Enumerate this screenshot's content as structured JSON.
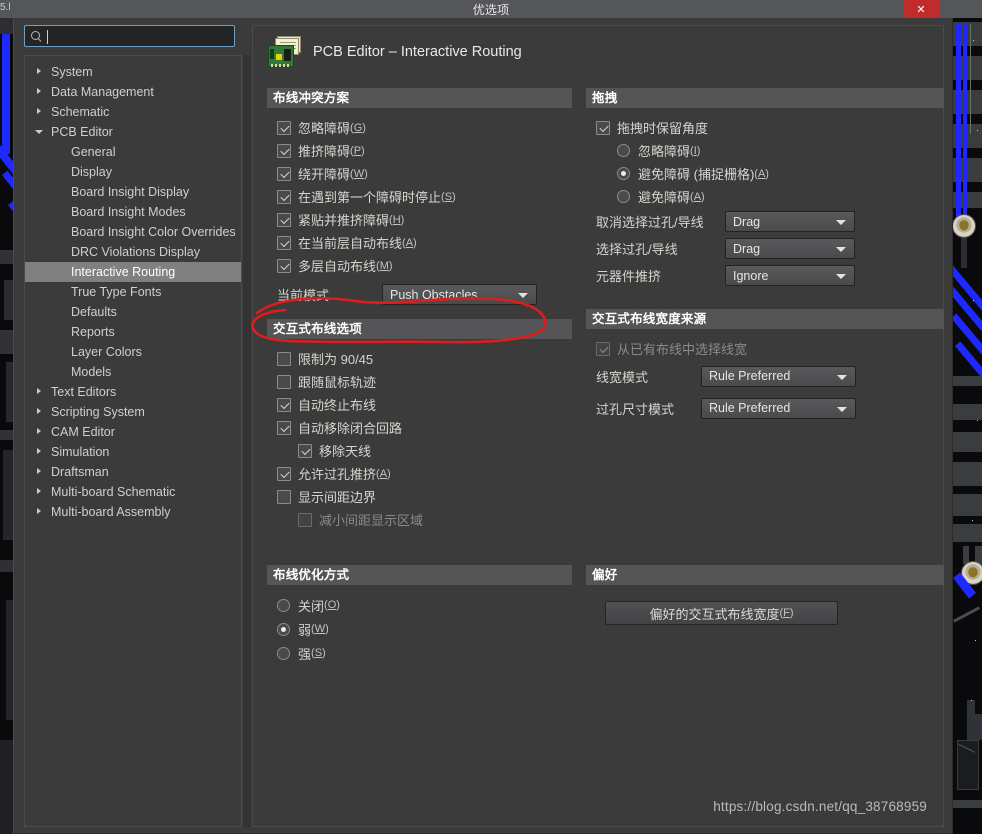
{
  "window": {
    "title": "优选项",
    "close_label": "✕",
    "version_fragment": "5.l"
  },
  "search": {
    "value": "",
    "placeholder": "",
    "icon": "search-icon"
  },
  "sidebar": {
    "items": [
      {
        "label": "System",
        "level": 0,
        "expandable": true,
        "expanded": false,
        "selected": false
      },
      {
        "label": "Data Management",
        "level": 0,
        "expandable": true,
        "expanded": false,
        "selected": false
      },
      {
        "label": "Schematic",
        "level": 0,
        "expandable": true,
        "expanded": false,
        "selected": false
      },
      {
        "label": "PCB Editor",
        "level": 0,
        "expandable": true,
        "expanded": true,
        "selected": false
      },
      {
        "label": "General",
        "level": 1,
        "expandable": false,
        "expanded": false,
        "selected": false
      },
      {
        "label": "Display",
        "level": 1,
        "expandable": false,
        "expanded": false,
        "selected": false
      },
      {
        "label": "Board Insight Display",
        "level": 1,
        "expandable": false,
        "expanded": false,
        "selected": false
      },
      {
        "label": "Board Insight Modes",
        "level": 1,
        "expandable": false,
        "expanded": false,
        "selected": false
      },
      {
        "label": "Board Insight Color Overrides",
        "level": 1,
        "expandable": false,
        "expanded": false,
        "selected": false
      },
      {
        "label": "DRC Violations Display",
        "level": 1,
        "expandable": false,
        "expanded": false,
        "selected": false
      },
      {
        "label": "Interactive Routing",
        "level": 1,
        "expandable": false,
        "expanded": false,
        "selected": true
      },
      {
        "label": "True Type Fonts",
        "level": 1,
        "expandable": false,
        "expanded": false,
        "selected": false
      },
      {
        "label": "Defaults",
        "level": 1,
        "expandable": false,
        "expanded": false,
        "selected": false
      },
      {
        "label": "Reports",
        "level": 1,
        "expandable": false,
        "expanded": false,
        "selected": false
      },
      {
        "label": "Layer Colors",
        "level": 1,
        "expandable": false,
        "expanded": false,
        "selected": false
      },
      {
        "label": "Models",
        "level": 1,
        "expandable": false,
        "expanded": false,
        "selected": false
      },
      {
        "label": "Text Editors",
        "level": 0,
        "expandable": true,
        "expanded": false,
        "selected": false
      },
      {
        "label": "Scripting System",
        "level": 0,
        "expandable": true,
        "expanded": false,
        "selected": false
      },
      {
        "label": "CAM Editor",
        "level": 0,
        "expandable": true,
        "expanded": false,
        "selected": false
      },
      {
        "label": "Simulation",
        "level": 0,
        "expandable": true,
        "expanded": false,
        "selected": false
      },
      {
        "label": "Draftsman",
        "level": 0,
        "expandable": true,
        "expanded": false,
        "selected": false
      },
      {
        "label": "Multi-board Schematic",
        "level": 0,
        "expandable": true,
        "expanded": false,
        "selected": false
      },
      {
        "label": "Multi-board Assembly",
        "level": 0,
        "expandable": true,
        "expanded": false,
        "selected": false
      }
    ]
  },
  "page": {
    "icon": "pcb-board-icon",
    "title": "PCB Editor – Interactive Routing"
  },
  "routing_conflict": {
    "group_title": "布线冲突方案",
    "options": [
      {
        "label": "忽略障碍",
        "hotkey": "G",
        "checked": true
      },
      {
        "label": "推挤障碍",
        "hotkey": "P",
        "checked": true
      },
      {
        "label": "绕开障碍",
        "hotkey": "W",
        "checked": true
      },
      {
        "label": "在遇到第一个障碍时停止",
        "hotkey": "S",
        "checked": true
      },
      {
        "label": "紧贴并推挤障碍",
        "hotkey": "H",
        "checked": true
      },
      {
        "label": "在当前层自动布线",
        "hotkey": "A",
        "checked": true
      },
      {
        "label": "多层自动布线",
        "hotkey": "M",
        "checked": true
      }
    ],
    "current_mode_label": "当前模式",
    "current_mode_value": "Push Obstacles"
  },
  "interactive_options": {
    "group_title": "交互式布线选项",
    "options": [
      {
        "label": "限制为 90/45",
        "hotkey": "",
        "checked": false,
        "indent": 0,
        "disabled": false
      },
      {
        "label": "跟随鼠标轨迹",
        "hotkey": "",
        "checked": false,
        "indent": 0,
        "disabled": false
      },
      {
        "label": "自动终止布线",
        "hotkey": "",
        "checked": true,
        "indent": 0,
        "disabled": false
      },
      {
        "label": "自动移除闭合回路",
        "hotkey": "",
        "checked": true,
        "indent": 0,
        "disabled": false
      },
      {
        "label": "移除天线",
        "hotkey": "",
        "checked": true,
        "indent": 1,
        "disabled": false
      },
      {
        "label": "允许过孔推挤",
        "hotkey": "A",
        "checked": true,
        "indent": 0,
        "disabled": false
      },
      {
        "label": "显示间距边界",
        "hotkey": "",
        "checked": false,
        "indent": 0,
        "disabled": false
      },
      {
        "label": "减小间距显示区域",
        "hotkey": "",
        "checked": false,
        "indent": 1,
        "disabled": true
      }
    ]
  },
  "optimization": {
    "group_title": "布线优化方式",
    "options": [
      {
        "label": "关闭",
        "hotkey": "O",
        "checked": false
      },
      {
        "label": "弱",
        "hotkey": "W",
        "checked": true
      },
      {
        "label": "强",
        "hotkey": "S",
        "checked": false
      }
    ]
  },
  "dragging": {
    "group_title": "拖拽",
    "preserve_angle": {
      "label": "拖拽时保留角度",
      "checked": true
    },
    "radios": [
      {
        "label": "忽略障碍",
        "hotkey": "I",
        "checked": false
      },
      {
        "label": "避免障碍 (捕捉栅格)",
        "hotkey": "A",
        "checked": true
      },
      {
        "label": "避免障碍",
        "hotkey": "A",
        "checked": false
      }
    ],
    "fields": [
      {
        "label": "取消选择过孔/导线",
        "value": "Drag"
      },
      {
        "label": "选择过孔/导线",
        "value": "Drag"
      },
      {
        "label": "元器件推挤",
        "value": "Ignore"
      }
    ]
  },
  "width_source": {
    "group_title": "交互式布线宽度来源",
    "checkbox": {
      "label": "从已有布线中选择线宽",
      "checked": true,
      "disabled": true
    },
    "fields": [
      {
        "label": "线宽模式",
        "value": "Rule Preferred"
      },
      {
        "label": "过孔尺寸模式",
        "value": "Rule Preferred"
      }
    ]
  },
  "favorites": {
    "group_title": "偏好",
    "button_label": "偏好的交互式布线宽度",
    "button_hotkey": "F"
  },
  "watermark": "https://blog.csdn.net/qq_38768959",
  "colors": {
    "accent_blue": "#6f9fc4",
    "close_red": "#c02c2c",
    "selection_gray": "#808080",
    "group_header": "#555557",
    "annotation_red": "#e01c1c",
    "trace_blue": "#1f28ff"
  }
}
